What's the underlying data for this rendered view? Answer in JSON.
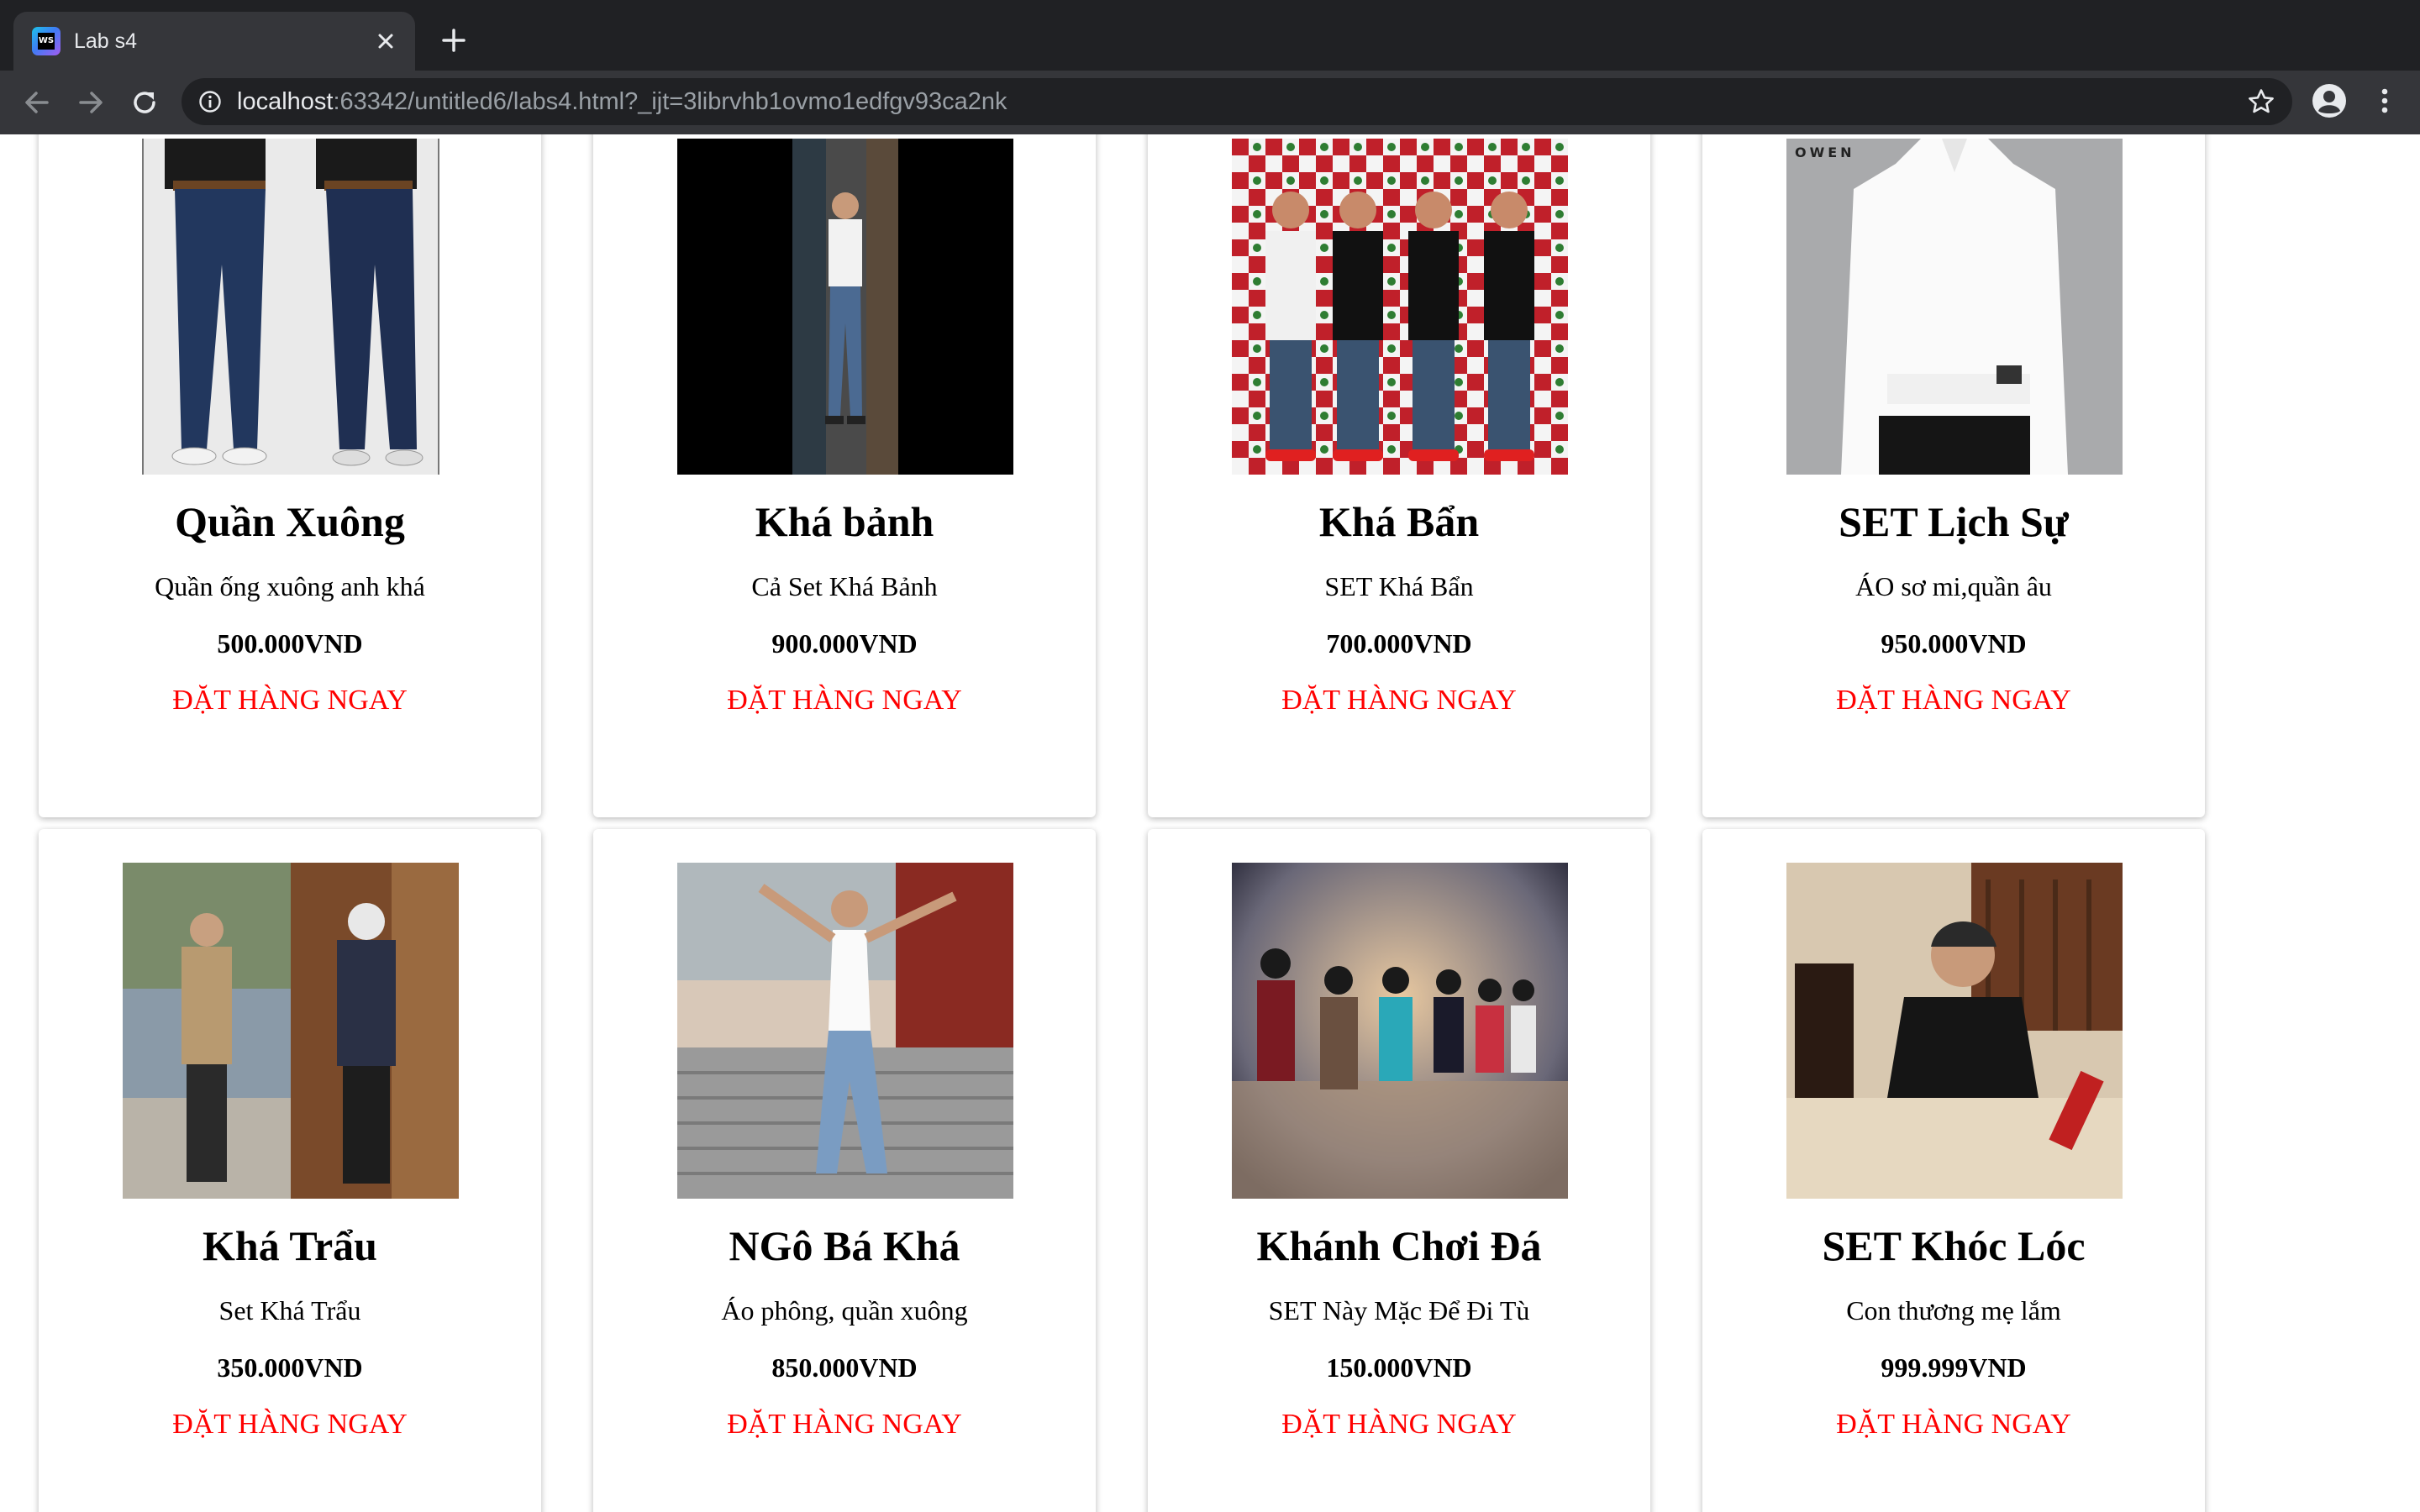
{
  "browser": {
    "tab_title": "Lab s4",
    "url_host": "localhost",
    "url_rest": ":63342/untitled6/labs4.html?_ijt=3librvhb1ovmo1edfgv93ca2nk"
  },
  "products": [
    {
      "name": "Quần Xuông",
      "desc": "Quần ống xuông anh khá",
      "price": "500.000VND",
      "order": "ĐẶT HÀNG NGAY"
    },
    {
      "name": "Khá bảnh",
      "desc": "Cả Set Khá Bảnh",
      "price": "900.000VND",
      "order": "ĐẶT HÀNG NGAY"
    },
    {
      "name": "Khá Bẩn",
      "desc": "SET Khá Bẩn",
      "price": "700.000VND",
      "order": "ĐẶT HÀNG NGAY"
    },
    {
      "name": "SET Lịch Sự",
      "desc": "ÁO sơ mi,quần âu",
      "price": "950.000VND",
      "order": "ĐẶT HÀNG NGAY"
    },
    {
      "name": "Khá Trẩu",
      "desc": "Set Khá Trẩu",
      "price": "350.000VND",
      "order": "ĐẶT HÀNG NGAY"
    },
    {
      "name": "NGô Bá Khá",
      "desc": "Áo phông, quần xuông",
      "price": "850.000VND",
      "order": "ĐẶT HÀNG NGAY"
    },
    {
      "name": "Khánh Chơi Đá",
      "desc": "SET Này Mặc Để Đi Tù",
      "price": "150.000VND",
      "order": "ĐẶT HÀNG NGAY"
    },
    {
      "name": "SET Khóc Lóc",
      "desc": "Con thương mẹ lắm",
      "price": "999.999VND",
      "order": "ĐẶT HÀNG NGAY"
    }
  ],
  "photo_watermarks": {
    "owen_logo": "OWEN"
  }
}
